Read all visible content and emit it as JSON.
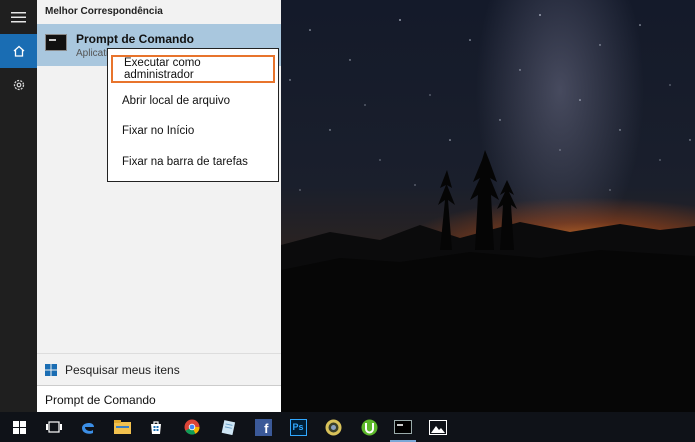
{
  "panel": {
    "section_header": "Melhor Correspondência",
    "best_match": {
      "title": "Prompt de Comando",
      "subtitle": "Aplicati"
    },
    "search_my_items": "Pesquisar meus itens",
    "query": "Prompt de Comando"
  },
  "context_menu": {
    "items": [
      "Executar como administrador",
      "Abrir local de arquivo",
      "Fixar no Início",
      "Fixar na barra de tarefas"
    ],
    "highlighted_index": 0
  },
  "rail": {
    "items": [
      "menu-icon",
      "home-icon",
      "settings-icon"
    ]
  },
  "taskbar": {
    "icons": [
      "windows-start-icon",
      "task-view-icon",
      "edge-icon",
      "file-explorer-icon",
      "store-icon",
      "chrome-icon",
      "notepad-icon",
      "facebook-icon",
      "photoshop-icon",
      "app-icon",
      "utorrent-icon",
      "command-prompt-icon",
      "photos-icon"
    ],
    "ps_label": "Ps",
    "fb_label": "f"
  },
  "colors": {
    "accent": "#1a6db3",
    "best_match_bg": "#a9c7de",
    "highlight_border": "#e8742c",
    "taskbar": "#0f1218"
  }
}
